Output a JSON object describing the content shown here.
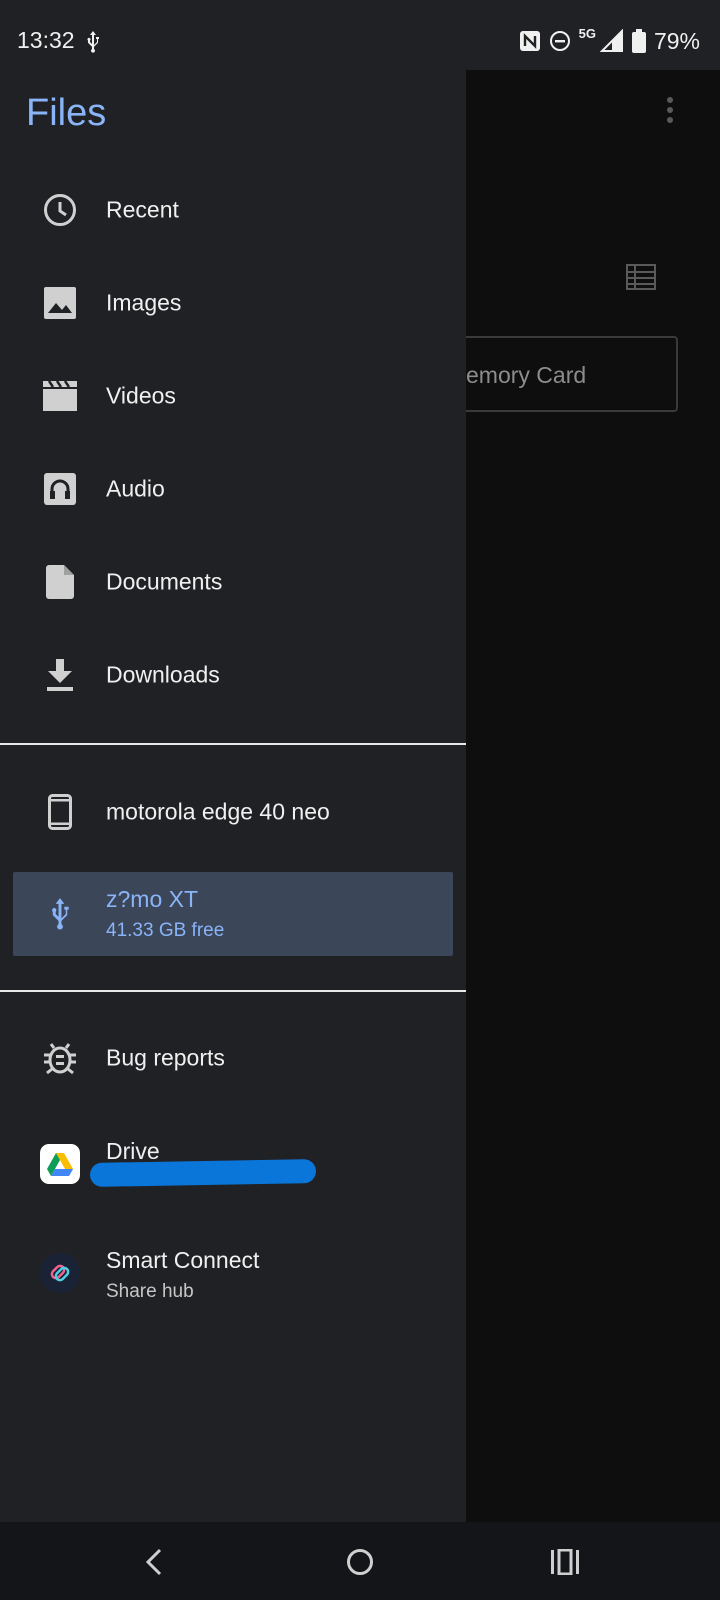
{
  "status_bar": {
    "time": "13:32",
    "network": "5G",
    "battery": "79%"
  },
  "background_app": {
    "storage_chip_label": "emory Card"
  },
  "drawer": {
    "title": "Files",
    "items": [
      {
        "label": "Recent",
        "icon": "clock-icon"
      },
      {
        "label": "Images",
        "icon": "image-icon"
      },
      {
        "label": "Videos",
        "icon": "video-icon"
      },
      {
        "label": "Audio",
        "icon": "headphones-icon"
      },
      {
        "label": "Documents",
        "icon": "document-icon"
      },
      {
        "label": "Downloads",
        "icon": "download-icon"
      }
    ],
    "devices": [
      {
        "label": "motorola edge 40 neo",
        "icon": "phone-icon"
      },
      {
        "label": "z?mo XT",
        "sub": "41.33 GB free",
        "icon": "usb-icon",
        "selected": true
      }
    ],
    "apps": [
      {
        "label": "Bug reports",
        "icon": "bug-icon"
      },
      {
        "label": "Drive",
        "icon": "google-drive-icon"
      },
      {
        "label": "Smart Connect",
        "sub": "Share hub",
        "icon": "smart-connect-icon"
      }
    ]
  },
  "colors": {
    "accent": "#8ab4f8",
    "drawer_bg": "#202124",
    "selected_bg": "#3c4659",
    "redaction": "#0b76d9"
  }
}
